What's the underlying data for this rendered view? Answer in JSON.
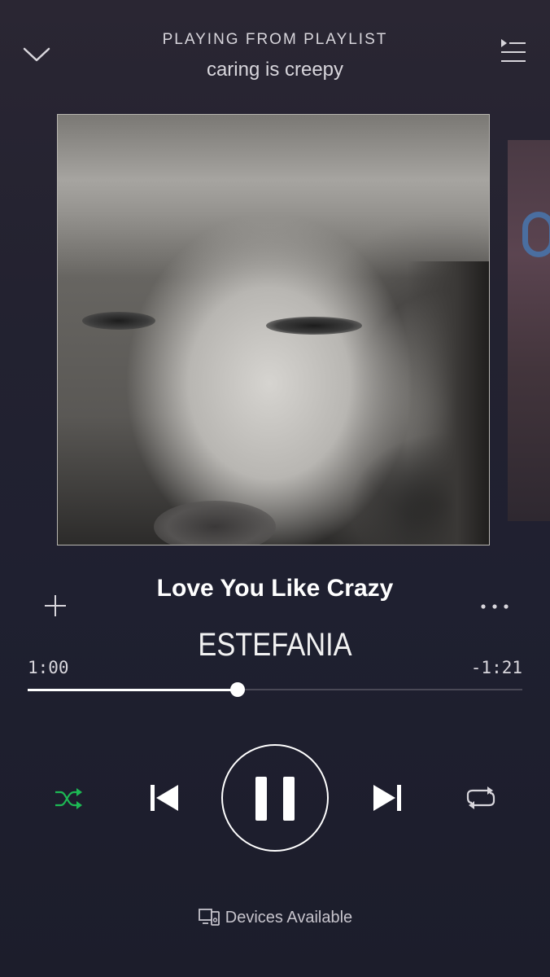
{
  "header": {
    "label": "PLAYING FROM PLAYLIST",
    "playlist_name": "caring is creepy",
    "collapse_icon": "chevron-down-icon",
    "queue_icon": "queue-icon"
  },
  "artwork": {
    "description_icon": "album-artwork"
  },
  "track": {
    "title": "Love You Like Crazy",
    "artist": "ESTEFANIA",
    "add_icon": "plus-icon",
    "more_icon": "more-dots-icon"
  },
  "progress": {
    "elapsed": "1:00",
    "remaining": "-1:21",
    "fraction": 0.425
  },
  "controls": {
    "shuffle_icon": "shuffle-icon",
    "previous_icon": "skip-previous-icon",
    "play_state": "pause",
    "next_icon": "skip-next-icon",
    "repeat_icon": "repeat-icon",
    "shuffle_active": true
  },
  "footer": {
    "devices_label": "Devices Available",
    "devices_icon": "devices-icon"
  },
  "colors": {
    "accent_green": "#1db954",
    "text_primary": "#ffffff",
    "text_secondary": "#d8d6dc",
    "background": "#1f2030"
  }
}
